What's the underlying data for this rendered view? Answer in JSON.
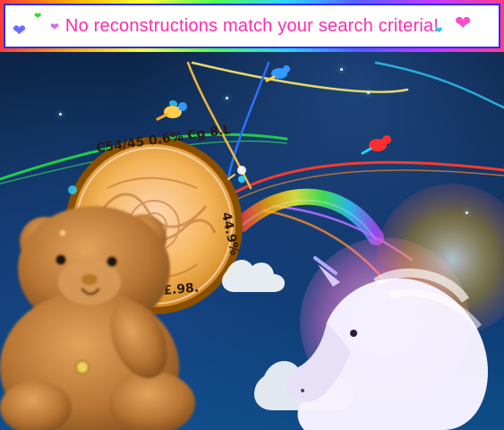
{
  "message": {
    "text": "No reconstructions match your search criteria!"
  },
  "decor": {
    "hearts": [
      {
        "name": "heart-blue-icon",
        "glyph": "❤",
        "color": "#6a6cff"
      },
      {
        "name": "heart-green-icon",
        "glyph": "❤",
        "color": "#2fdc2f"
      },
      {
        "name": "heart-purple-icon",
        "glyph": "❤",
        "color": "#d06bff"
      },
      {
        "name": "heart-pink-icon",
        "glyph": "❤",
        "color": "#ff4bc8"
      },
      {
        "name": "heart-cyan-icon",
        "glyph": "❤",
        "color": "#20c6ff"
      }
    ],
    "coin_text": [
      "C54/45 0.6% Cg 8.L",
      "44.9%",
      "49.£.98."
    ]
  },
  "colors": {
    "banner_text": "#ff2bb0",
    "sky_dark": "#0b1e3d",
    "sky_light": "#0e4d88"
  }
}
